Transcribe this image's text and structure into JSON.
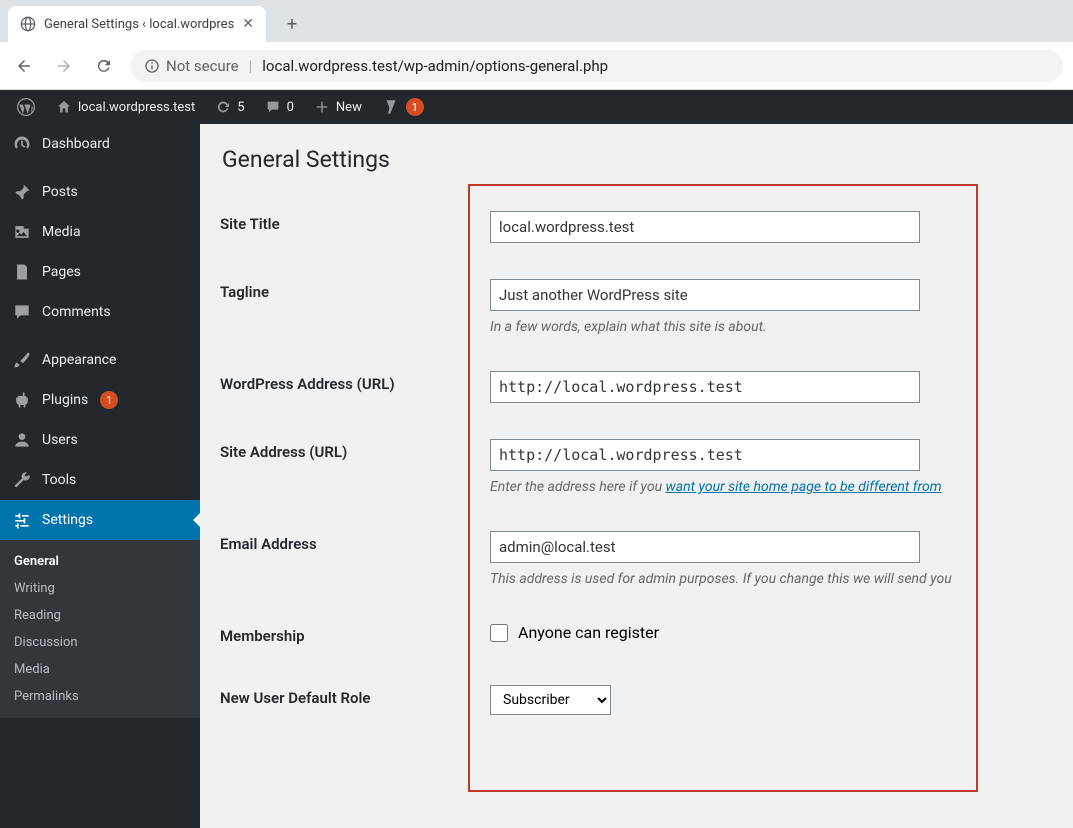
{
  "browser": {
    "tab_title": "General Settings ‹ local.wordpres",
    "not_secure": "Not secure",
    "url": "local.wordpress.test/wp-admin/options-general.php"
  },
  "adminbar": {
    "site_name": "local.wordpress.test",
    "updates": "5",
    "comments": "0",
    "new": "New",
    "yoast_badge": "1"
  },
  "sidebar": {
    "dashboard": "Dashboard",
    "posts": "Posts",
    "media": "Media",
    "pages": "Pages",
    "comments": "Comments",
    "appearance": "Appearance",
    "plugins": "Plugins",
    "plugins_badge": "1",
    "users": "Users",
    "tools": "Tools",
    "settings": "Settings",
    "submenu": {
      "general": "General",
      "writing": "Writing",
      "reading": "Reading",
      "discussion": "Discussion",
      "media": "Media",
      "permalinks": "Permalinks"
    }
  },
  "page": {
    "title": "General Settings",
    "site_title_label": "Site Title",
    "site_title_value": "local.wordpress.test",
    "tagline_label": "Tagline",
    "tagline_value": "Just another WordPress site",
    "tagline_desc": "In a few words, explain what this site is about.",
    "wp_address_label": "WordPress Address (URL)",
    "wp_address_value": "http://local.wordpress.test",
    "site_address_label": "Site Address (URL)",
    "site_address_value": "http://local.wordpress.test",
    "site_address_desc_pre": "Enter the address here if you ",
    "site_address_desc_link": "want your site home page to be different from",
    "email_label": "Email Address",
    "email_value": "admin@local.test",
    "email_desc": "This address is used for admin purposes. If you change this we will send you",
    "membership_label": "Membership",
    "membership_check": "Anyone can register",
    "default_role_label": "New User Default Role",
    "default_role_value": "Subscriber"
  }
}
